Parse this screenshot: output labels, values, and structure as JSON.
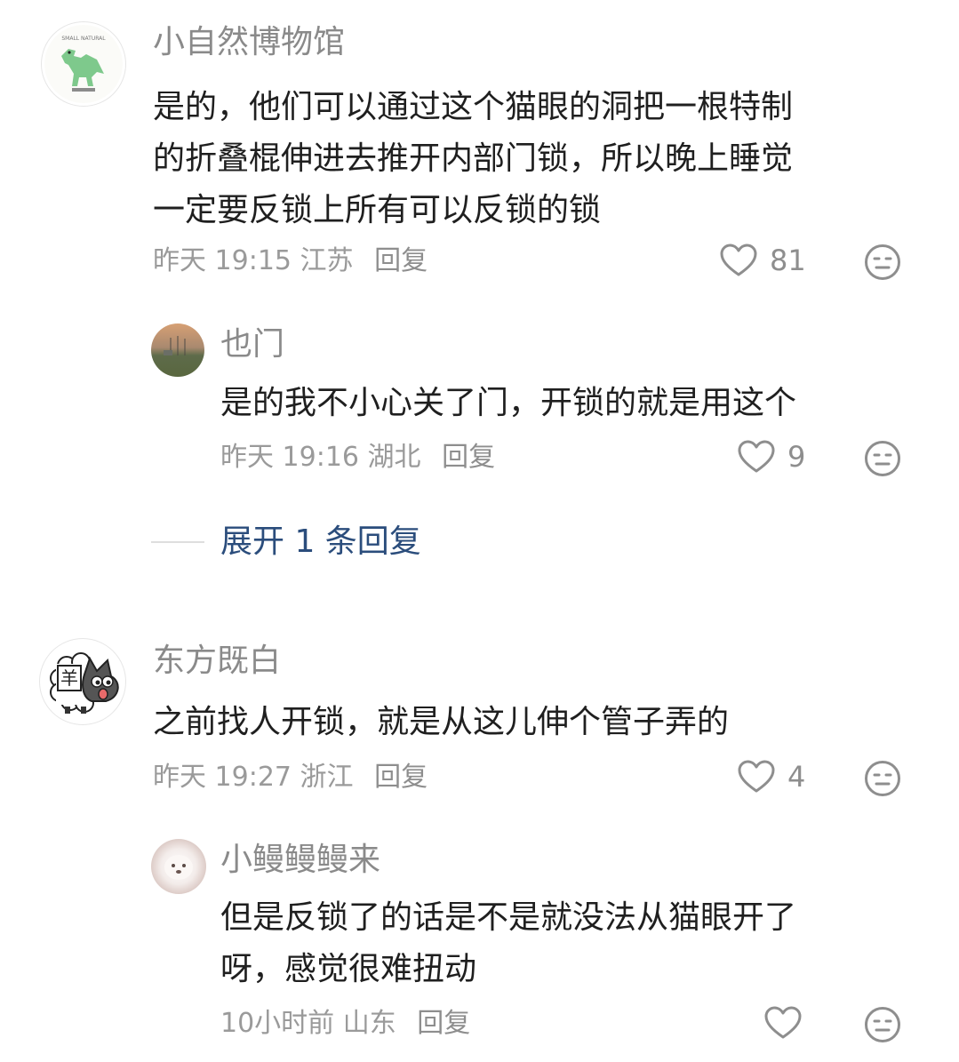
{
  "comments": [
    {
      "author": "小自然博物馆",
      "avatar": "dinosaur-stamp-avatar",
      "text_lines": [
        "是的，他们可以通过这个猫眼的洞把一根特制",
        "的折叠棍伸进去推开内部门锁，所以晚上睡觉",
        "一定要反锁上所有可以反锁的锁"
      ],
      "time": "昨天 19:15",
      "location": "江苏",
      "reply_label": "回复",
      "likes": "81",
      "replies": [
        {
          "author": "也门",
          "avatar": "sunset-field-avatar",
          "text_lines": [
            "是的我不小心关了门，开锁的就是用这个"
          ],
          "time": "昨天 19:16",
          "location": "湖北",
          "reply_label": "回复",
          "likes": "9"
        }
      ],
      "expand_label": "展开 1 条回复"
    },
    {
      "author": "东方既白",
      "avatar": "sheep-wolf-cartoon-avatar",
      "text_lines": [
        "之前找人开锁，就是从这儿伸个管子弄的"
      ],
      "time": "昨天 19:27",
      "location": "浙江",
      "reply_label": "回复",
      "likes": "4",
      "replies": [
        {
          "author": "小鳗鳗鳗来",
          "avatar": "white-puppy-avatar",
          "text_lines": [
            "但是反锁了的话是不是就没法从猫眼开了",
            "呀，感觉很难扭动"
          ],
          "time": "10小时前",
          "location": "山东",
          "reply_label": "回复",
          "likes": ""
        }
      ]
    }
  ],
  "icons": {
    "like": "heart-outline-icon",
    "dislike": "neutral-face-icon"
  },
  "colors": {
    "author": "#8a8a8a",
    "text": "#1f1f1f",
    "meta": "#9a9a9a",
    "expand": "#2b4d7c"
  }
}
